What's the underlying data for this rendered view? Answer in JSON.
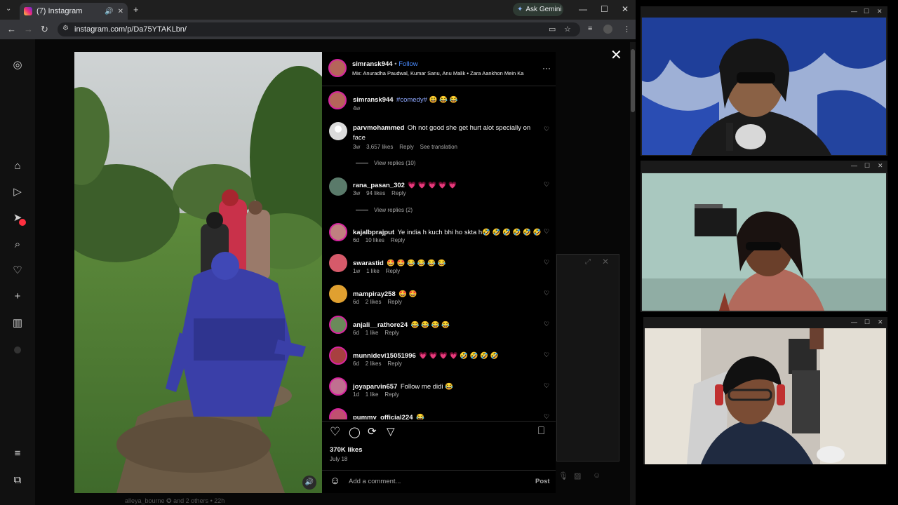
{
  "browser": {
    "tab_title": "(7) Instagram",
    "url": "instagram.com/p/Da75YTAKLbn/",
    "gemini_label": "Ask Gemini"
  },
  "post": {
    "author": "simransk944",
    "follow_label": "Follow",
    "audio": "Mix: Anuradha Paudwal, Kumar Sanu, Anu Malik • Zara Aankhon Mein Ka",
    "caption_user": "simransk944",
    "caption_text": "#comedy# 😃 😂 😂",
    "caption_age": "4w",
    "likes": "370K likes",
    "date": "July 18",
    "comment_placeholder": "Add a comment...",
    "post_label": "Post"
  },
  "comments": [
    {
      "user": "parvmohammed",
      "text": "Oh not good she get hurt alot specially on face",
      "age": "3w",
      "likes": "3,657 likes",
      "reply": "Reply",
      "extra": "See translation",
      "replies": "View replies (10)"
    },
    {
      "user": "rana_pasan_302",
      "text": "💗 💗 💗 💗 💗",
      "age": "3w",
      "likes": "94 likes",
      "reply": "Reply",
      "replies": "View replies (2)"
    },
    {
      "user": "kajalbprajput",
      "text": "Ye india h kuch bhi ho skta h🤣 🤣 🤣 🤣 🤣 🤣",
      "age": "6d",
      "likes": "10 likes",
      "reply": "Reply"
    },
    {
      "user": "swarastid",
      "text": "🤩 🤩 😂 😂 😂 😂",
      "age": "1w",
      "likes": "1 like",
      "reply": "Reply"
    },
    {
      "user": "mampiray258",
      "text": "🤩 🤩",
      "age": "6d",
      "likes": "2 likes",
      "reply": "Reply"
    },
    {
      "user": "anjali__rathore24",
      "text": "😂 😂 😂 😂",
      "age": "6d",
      "likes": "1 like",
      "reply": "Reply"
    },
    {
      "user": "munnidevi15051996",
      "text": "💗 💗 💗 💗 🤣 🤣 🤣 🤣",
      "age": "6d",
      "likes": "2 likes",
      "reply": "Reply"
    },
    {
      "user": "joyaparvin657",
      "text": "Follow me didi 😂",
      "age": "1d",
      "likes": "1 like",
      "reply": "Reply"
    },
    {
      "user": "pummy_official224",
      "text": "😂",
      "age": "",
      "likes": "",
      "reply": ""
    }
  ],
  "background": {
    "footer_text": "alleya_bourne ✪ and 2 others • 22h"
  },
  "colors": {
    "accent_blue": "#4a8cff",
    "hashtag": "#8ea8ff",
    "notification_red": "#ff3040"
  }
}
